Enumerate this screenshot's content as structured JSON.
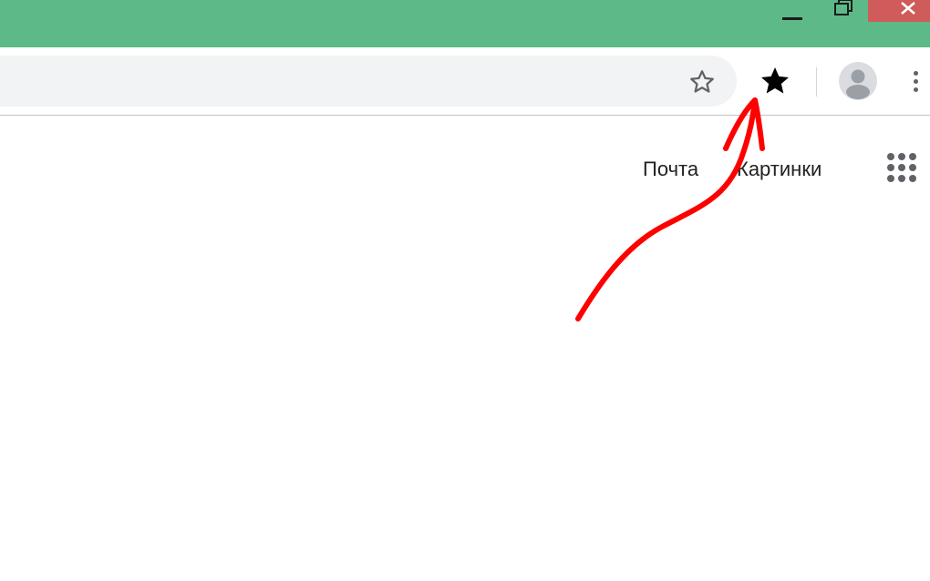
{
  "window_controls": {
    "minimize_icon": "minimize-icon",
    "restore_icon": "restore-icon",
    "close_icon": "close-icon",
    "titlebar_color": "#5dba88",
    "close_color": "#cf5b5b"
  },
  "toolbar": {
    "omnibox_value": "",
    "bookmark_icon": "star-outline-icon",
    "extension_icon": "star-filled-icon",
    "profile_icon": "avatar-icon",
    "menu_icon": "kebab-menu-icon"
  },
  "google_links": {
    "mail": "Почта",
    "images": "Картинки",
    "apps_icon": "apps-grid-icon"
  },
  "annotation": {
    "type": "hand-drawn arrow",
    "color": "#ff0000"
  }
}
